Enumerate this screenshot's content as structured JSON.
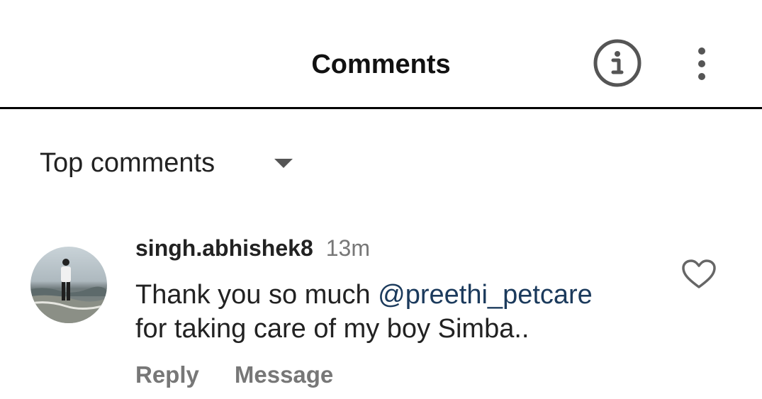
{
  "header": {
    "title": "Comments",
    "info_icon": "info-circle-icon",
    "more_icon": "more-vertical-icon"
  },
  "sort": {
    "label": "Top comments",
    "caret_icon": "caret-down-icon"
  },
  "comment": {
    "username": "singh.abhishek8",
    "time": "13m",
    "text_before": "Thank you so much ",
    "mention": "@preethi_petcare",
    "text_after": "for taking care of my boy Simba..",
    "reply_label": "Reply",
    "message_label": "Message",
    "like_icon": "heart-outline-icon"
  },
  "colors": {
    "mention": "#1b3a5c",
    "secondary_text": "#777777",
    "divider": "#000000"
  }
}
